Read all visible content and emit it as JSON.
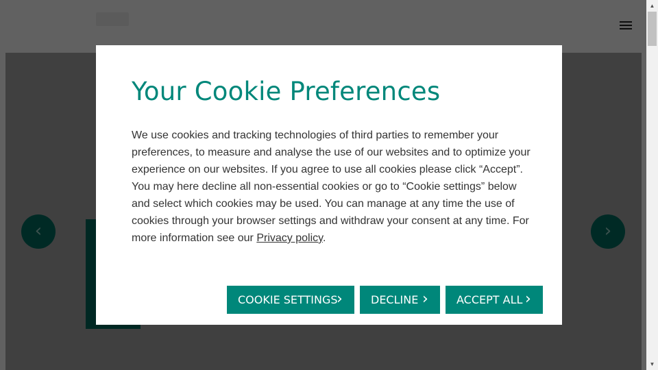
{
  "colors": {
    "accent": "#00877a",
    "carousel": "#006e63",
    "overlay": "rgba(0,0,0,0.62)"
  },
  "header": {
    "menu_icon": "hamburger-menu-icon"
  },
  "carousel": {
    "prev_icon": "chevron-left-icon",
    "next_icon": "chevron-right-icon",
    "prev_glyph": "‹",
    "next_glyph": "›"
  },
  "cookie_modal": {
    "title": "Your Cookie Preferences",
    "body_text": "We use cookies and tracking technologies of third parties to remember your preferences, to measure and analyse the use of our websites and to optimize your experience on our websites. If you agree to use all cookies please click “Accept”. You may here decline all non-essential cookies or go to “Cookie settings” below and select which cookies may be used. You can manage at any time the use of cookies through your browser settings and withdraw your consent at any time. For more information see our ",
    "privacy_link": "Privacy policy",
    "body_end": ".",
    "buttons": {
      "settings": "COOKIE SETTINGS",
      "decline": "DECLINE",
      "accept": "ACCEPT ALL"
    },
    "chevron_glyph": "›"
  },
  "scrollbar": {
    "up_glyph": "▲",
    "down_glyph": "▼"
  }
}
